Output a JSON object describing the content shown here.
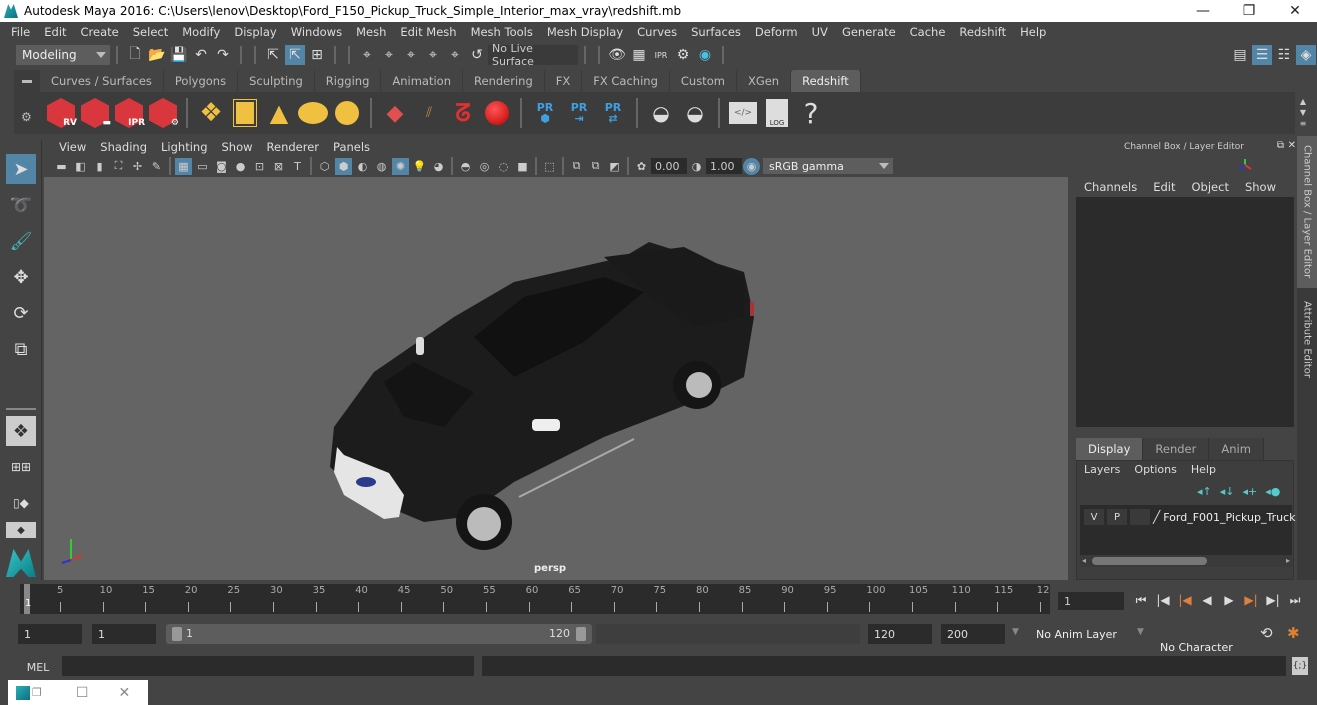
{
  "window": {
    "title": "Autodesk Maya 2016: C:\\Users\\lenov\\Desktop\\Ford_F150_Pickup_Truck_Simple_Interior_max_vray\\redshift.mb",
    "minimize": "—",
    "restore": "❐",
    "close": "✕"
  },
  "menu": [
    "File",
    "Edit",
    "Create",
    "Select",
    "Modify",
    "Display",
    "Windows",
    "Mesh",
    "Edit Mesh",
    "Mesh Tools",
    "Mesh Display",
    "Curves",
    "Surfaces",
    "Deform",
    "UV",
    "Generate",
    "Cache",
    "Redshift",
    "Help"
  ],
  "statusline": {
    "mode": "Modeling",
    "live_surface": "No Live Surface"
  },
  "shelf": {
    "tabs": [
      "Curves / Surfaces",
      "Polygons",
      "Sculpting",
      "Rigging",
      "Animation",
      "Rendering",
      "FX",
      "FX Caching",
      "Custom",
      "XGen",
      "Redshift"
    ],
    "active_tab": "Redshift",
    "rs_labels": [
      "RV",
      "",
      "IPR",
      ""
    ],
    "pr_label": "PR",
    "help": "?",
    "log": "LOG"
  },
  "viewport": {
    "menu": [
      "View",
      "Shading",
      "Lighting",
      "Show",
      "Renderer",
      "Panels"
    ],
    "exposure": "0.00",
    "gamma": "1.00",
    "color_space": "sRGB gamma",
    "camera": "persp"
  },
  "channel_box": {
    "title": "Channel Box / Layer Editor",
    "menu": [
      "Channels",
      "Edit",
      "Object",
      "Show"
    ],
    "side_tabs": [
      "Channel Box / Layer Editor",
      "Attribute Editor"
    ]
  },
  "layer_editor": {
    "tabs": [
      "Display",
      "Render",
      "Anim"
    ],
    "active_tab": "Display",
    "menu": [
      "Layers",
      "Options",
      "Help"
    ],
    "layers": [
      {
        "v": "V",
        "p": "P",
        "name": "Ford_F001_Pickup_Truck"
      }
    ]
  },
  "timeline": {
    "ticks": [
      "5",
      "10",
      "15",
      "20",
      "25",
      "30",
      "35",
      "40",
      "45",
      "50",
      "55",
      "60",
      "65",
      "70",
      "75",
      "80",
      "85",
      "90",
      "95",
      "100",
      "105",
      "110",
      "115",
      "12"
    ],
    "start_marker": "1",
    "current_frame": "1",
    "start_frame": "1",
    "start_time": "1",
    "range_start": "1",
    "range_end": "120",
    "end_time": "120",
    "end_frame": "200",
    "anim_layer": "No Anim Layer",
    "character_set": "No Character Set"
  },
  "command_line": {
    "label": "MEL"
  },
  "minimized": {
    "restore": "❐",
    "maximize": "☐",
    "close": "✕"
  }
}
